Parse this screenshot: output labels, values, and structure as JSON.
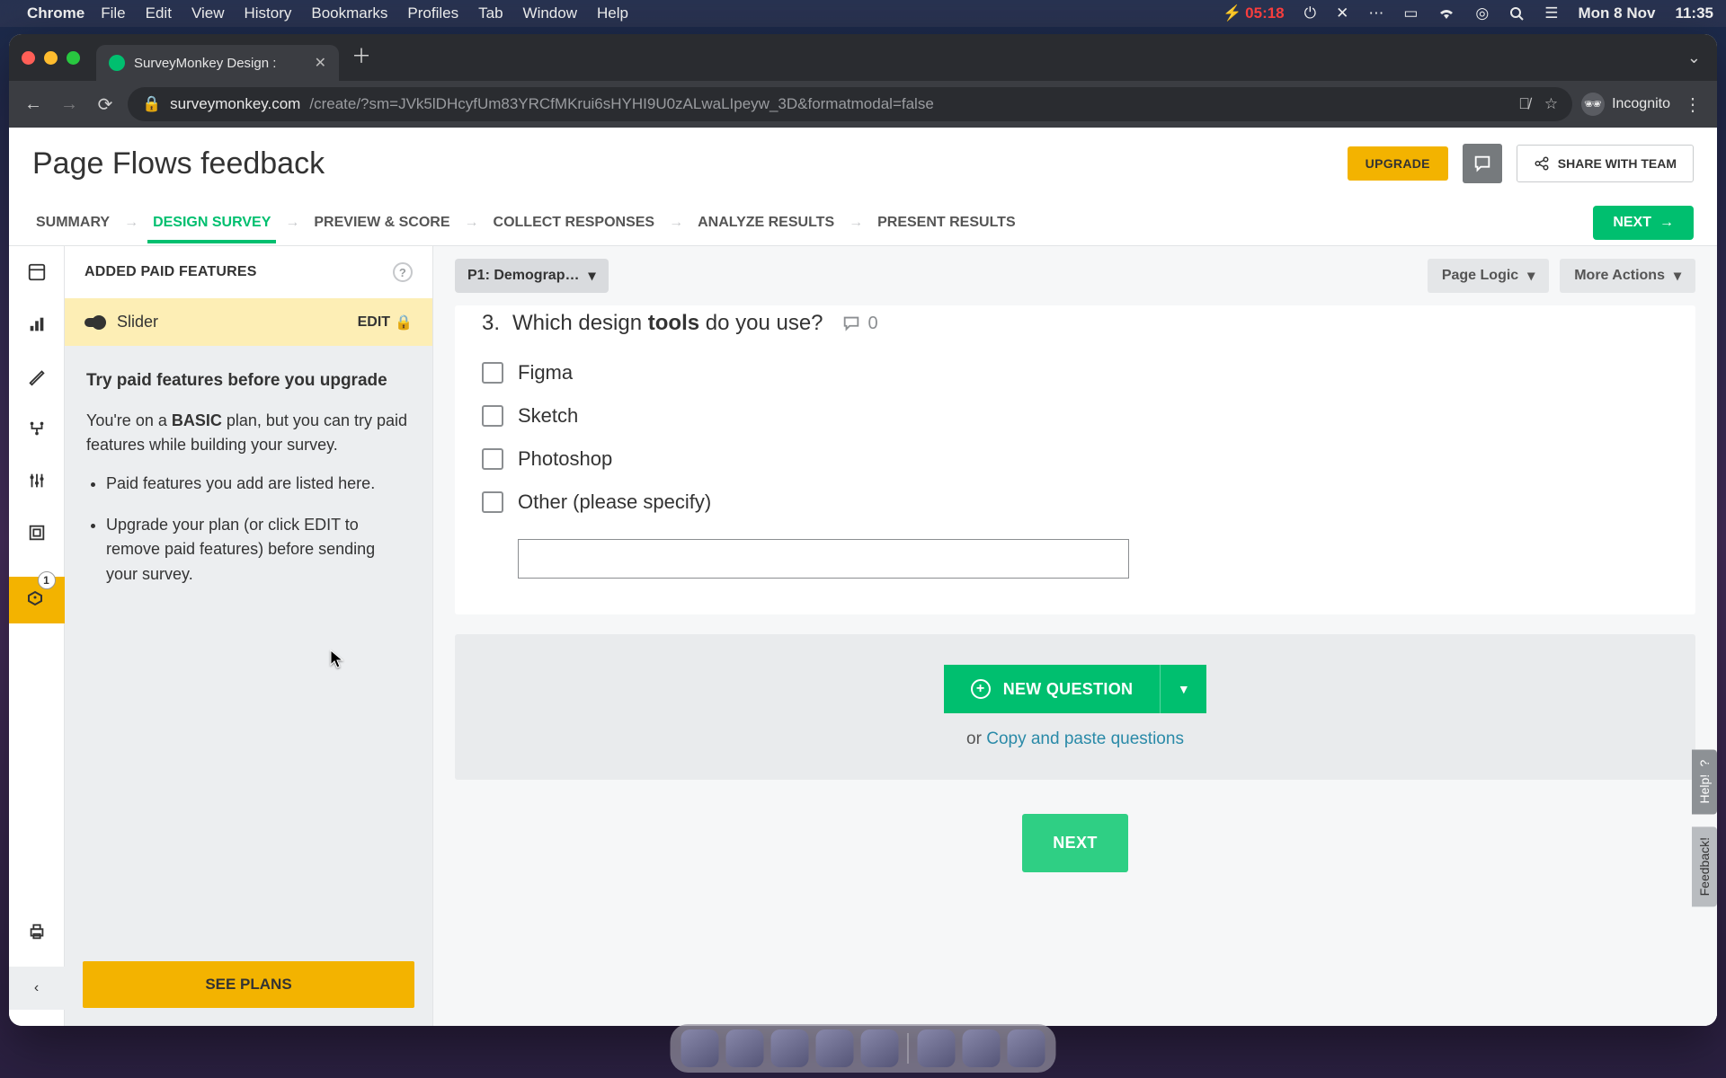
{
  "mac": {
    "app": "Chrome",
    "menus": [
      "File",
      "Edit",
      "View",
      "History",
      "Bookmarks",
      "Profiles",
      "Tab",
      "Window",
      "Help"
    ],
    "battery": "05:18",
    "date": "Mon 8 Nov",
    "time": "11:35"
  },
  "chrome": {
    "tab_title": "SurveyMonkey Design :",
    "url_host": "surveymonkey.com",
    "url_path": "/create/?sm=JVk5lDHcyfUm83YRCfMKrui6sHYHI9U0zALwaLIpeyw_3D&formatmodal=false",
    "incognito": "Incognito"
  },
  "header": {
    "title": "Page Flows feedback",
    "upgrade": "UPGRADE",
    "share": "SHARE WITH TEAM"
  },
  "tabs": {
    "steps": [
      "SUMMARY",
      "DESIGN SURVEY",
      "PREVIEW & SCORE",
      "COLLECT RESPONSES",
      "ANALYZE RESULTS",
      "PRESENT RESULTS"
    ],
    "active_index": 1,
    "next": "NEXT"
  },
  "rail": {
    "badge": "1"
  },
  "sidepanel": {
    "head": "ADDED PAID FEATURES",
    "slider_label": "Slider",
    "edit": "EDIT",
    "promo_title": "Try paid features before you upgrade",
    "promo_p_pre": "You're on a ",
    "promo_p_plan": "BASIC",
    "promo_p_post": " plan, but you can try paid features while building your survey.",
    "bullets": [
      "Paid features you add are listed here.",
      "Upgrade your plan (or click EDIT to remove paid features) before sending your survey."
    ],
    "see_plans": "SEE PLANS"
  },
  "canvas": {
    "page_picker": "P1: Demograp…",
    "page_logic": "Page Logic",
    "more_actions": "More Actions",
    "question": {
      "num": "3.",
      "pre": "Which design ",
      "bold": "tools",
      "post": " do you use?",
      "responses": "0",
      "options": [
        "Figma",
        "Sketch",
        "Photoshop",
        "Other (please specify)"
      ]
    },
    "new_question": "NEW QUESTION",
    "copy_pre": "or ",
    "copy_link": "Copy and paste questions",
    "next": "NEXT"
  },
  "sidetabs": {
    "help": "Help!",
    "feedback": "Feedback!"
  }
}
